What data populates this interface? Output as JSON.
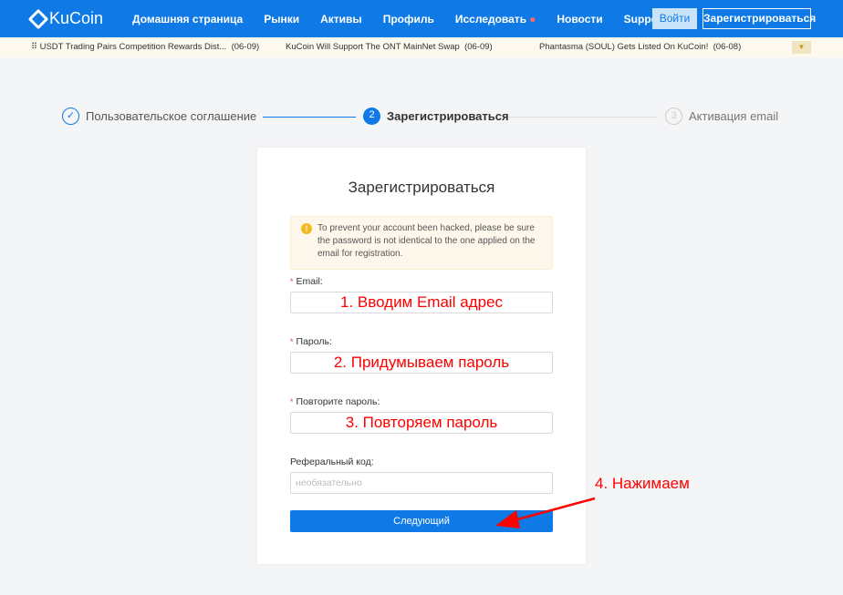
{
  "nav": {
    "logo": "KuCoin",
    "items": [
      "Домашняя страница",
      "Рынки",
      "Активы",
      "Профиль",
      "Исследовать",
      "Новости",
      "Support"
    ],
    "login": "Войти",
    "register": "Зарегистрироваться",
    "accent": "#0f7ae5"
  },
  "ticker": [
    {
      "text": "USDT Trading Pairs Competition Rewards Dist...",
      "date": "(06-09)"
    },
    {
      "text": "KuCoin Will Support The ONT MainNet Swap",
      "date": "(06-09)"
    },
    {
      "text": "Phantasma (SOUL) Gets Listed On KuCoin!",
      "date": "(06-08)"
    }
  ],
  "steps": [
    {
      "num": "✓",
      "label": "Пользовательское соглашение",
      "state": "done"
    },
    {
      "num": "2",
      "label": "Зарегистрироваться",
      "state": "active"
    },
    {
      "num": "3",
      "label": "Активация email",
      "state": "pending"
    }
  ],
  "form": {
    "title": "Зарегистрироваться",
    "warning": "To prevent your account been hacked, please be sure the password is not identical to the one applied on the email for registration.",
    "email_label": "Email",
    "email_value": "1. Вводим Email адрес",
    "password_label": "Пароль",
    "password_value": "2. Придумываем пароль",
    "repeat_label": "Повторите пароль",
    "repeat_value": "3. Повторяем пароль",
    "referral_label": "Реферальный код",
    "referral_placeholder": "необязательно",
    "submit": "Следующий"
  },
  "annotation": "4. Нажимаем"
}
